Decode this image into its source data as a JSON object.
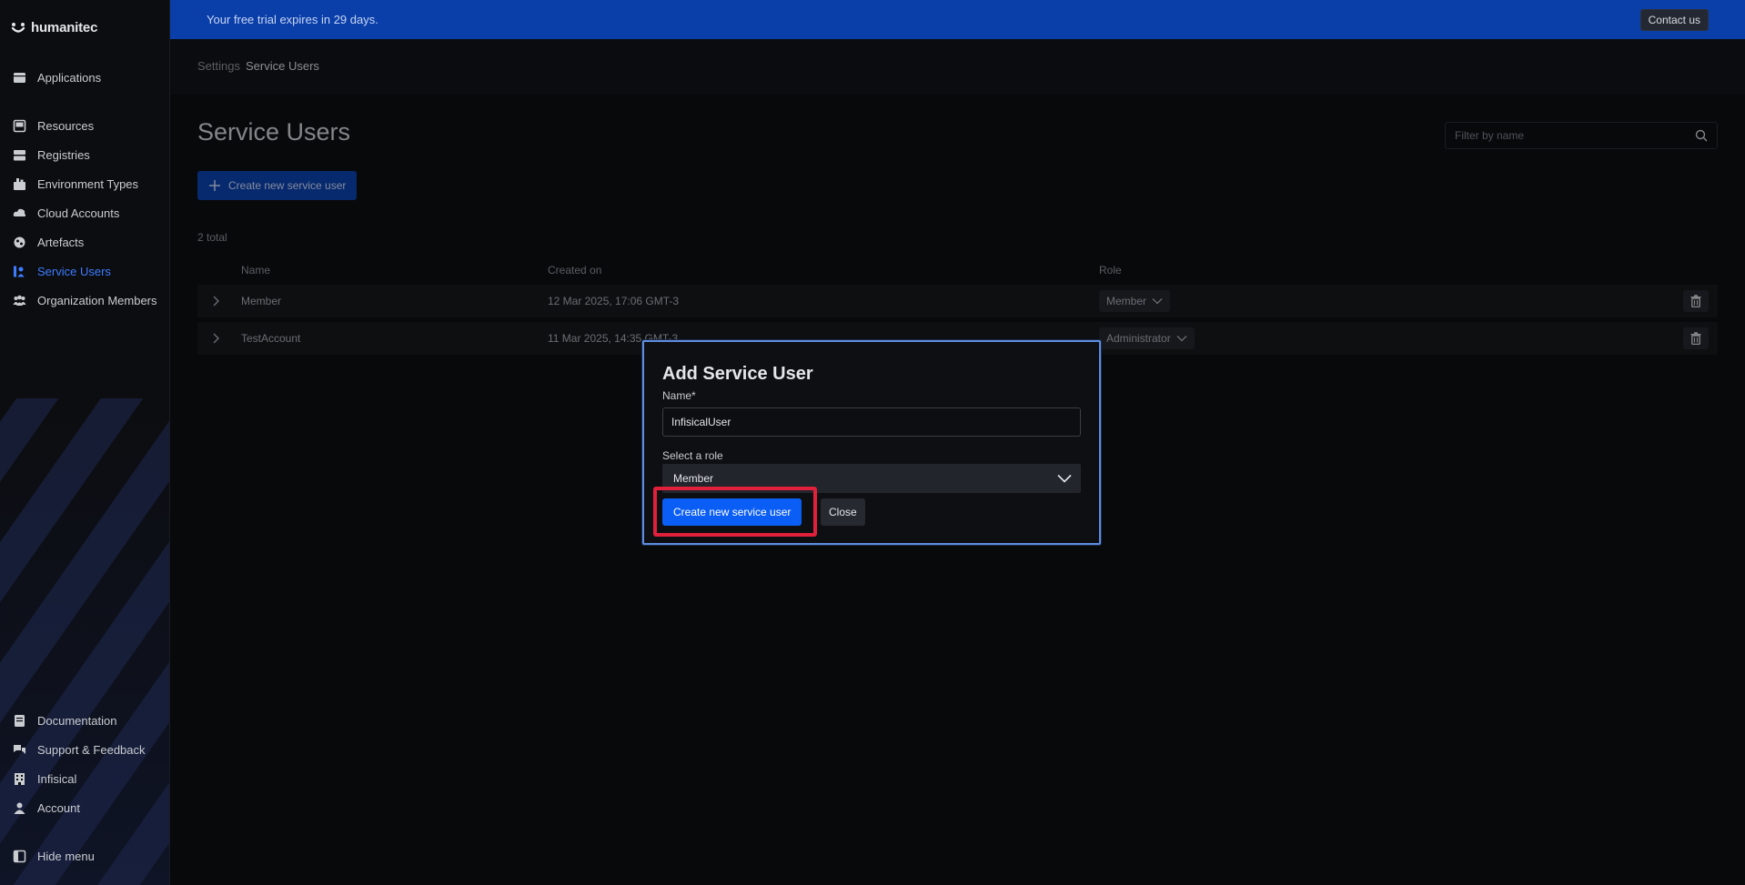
{
  "brand": {
    "name": "humanitec"
  },
  "sidebar": {
    "items": [
      {
        "label": "Applications",
        "icon": "applications-icon"
      },
      {
        "label": "Resources",
        "icon": "resources-icon"
      },
      {
        "label": "Registries",
        "icon": "registries-icon"
      },
      {
        "label": "Environment Types",
        "icon": "environment-types-icon"
      },
      {
        "label": "Cloud Accounts",
        "icon": "cloud-accounts-icon"
      },
      {
        "label": "Artefacts",
        "icon": "artefacts-icon"
      },
      {
        "label": "Service Users",
        "icon": "service-users-icon",
        "active": true
      },
      {
        "label": "Organization Members",
        "icon": "organization-members-icon"
      }
    ],
    "bottom_items": [
      {
        "label": "Documentation",
        "icon": "documentation-icon"
      },
      {
        "label": "Support & Feedback",
        "icon": "support-icon"
      },
      {
        "label": "Infisical",
        "icon": "organization-icon"
      },
      {
        "label": "Account",
        "icon": "account-icon"
      }
    ],
    "hide_menu": "Hide menu"
  },
  "banner": {
    "text": "Your free trial expires in 29 days.",
    "contact_label": "Contact us"
  },
  "breadcrumb": {
    "parent": "Settings",
    "current": "Service Users"
  },
  "page": {
    "title": "Service Users",
    "filter_placeholder": "Filter by name",
    "create_label": "Create new service user",
    "total": "2 total"
  },
  "table": {
    "headers": {
      "name": "Name",
      "created": "Created on",
      "role": "Role"
    },
    "rows": [
      {
        "name": "Member",
        "created": "12 Mar 2025, 17:06 GMT-3",
        "role": "Member"
      },
      {
        "name": "TestAccount",
        "created": "11 Mar 2025, 14:35 GMT-3",
        "role": "Administrator"
      }
    ]
  },
  "modal": {
    "title": "Add Service User",
    "name_label": "Name*",
    "name_value": "InfisicalUser",
    "role_label": "Select a role",
    "role_value": "Member",
    "submit_label": "Create new service user",
    "close_label": "Close"
  },
  "colors": {
    "accent": "#3d7cff",
    "banner": "#0a3ea8",
    "primary_button": "#0b5ef5",
    "highlight": "#e1213c"
  }
}
